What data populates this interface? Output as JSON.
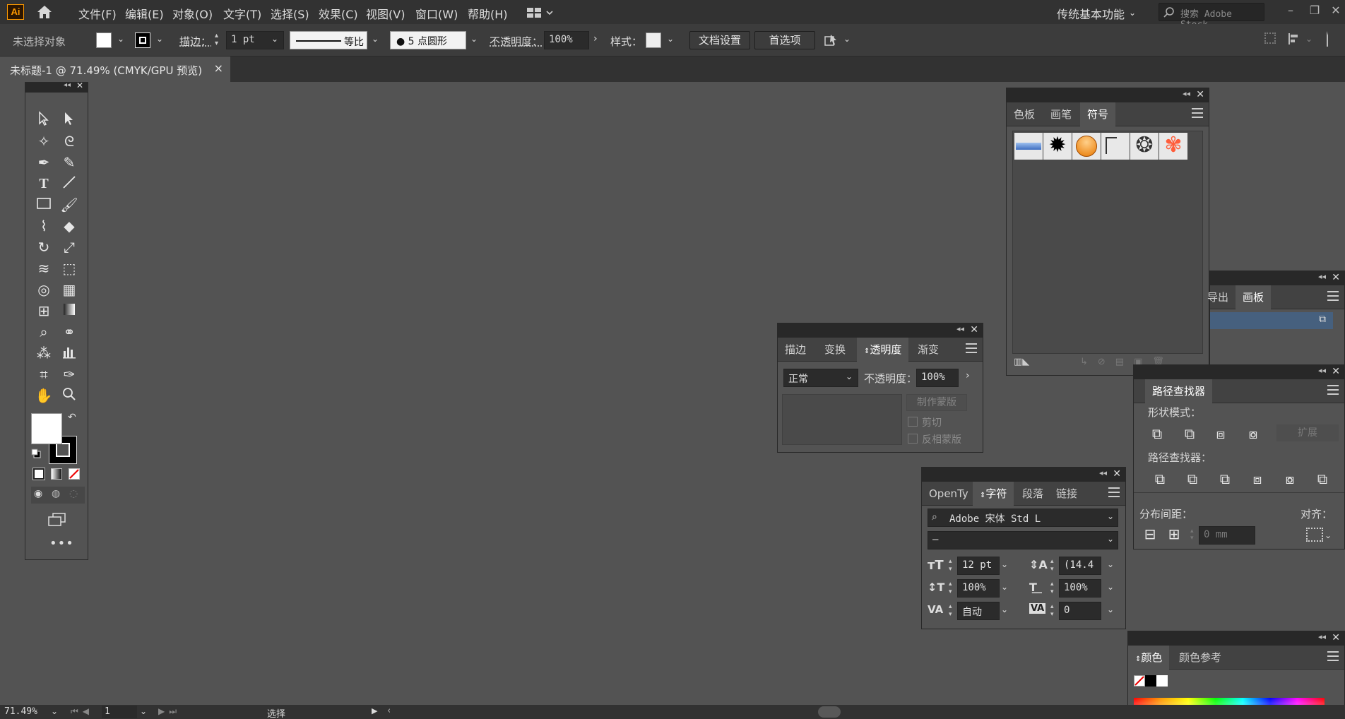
{
  "app": {
    "logo_text": "Ai"
  },
  "menu": [
    "文件(F)",
    "编辑(E)",
    "对象(O)",
    "文字(T)",
    "选择(S)",
    "效果(C)",
    "视图(V)",
    "窗口(W)",
    "帮助(H)"
  ],
  "workspace": "传统基本功能",
  "search": {
    "placeholder": "搜索 Adobe Stock"
  },
  "control": {
    "no_selection": "未选择对象",
    "stroke_label": "描边：",
    "stroke_value": "1 pt",
    "profile_label": "等比",
    "brush_label": "5 点圆形",
    "opacity_label": "不透明度：",
    "opacity_value": "100%",
    "style_label": "样式：",
    "doc_settings": "文档设置",
    "preferences": "首选项"
  },
  "document_tab": {
    "title": "未标题-1 @ 71.49% (CMYK/GPU 预览)",
    "close": "×"
  },
  "swatch_panel": {
    "tabs": [
      "色板",
      "画笔",
      "符号"
    ],
    "active": "符号"
  },
  "transparency_panel": {
    "tabs": [
      "描边",
      "变换",
      "透明度",
      "渐变"
    ],
    "active": "透明度",
    "blend_mode": "正常",
    "opacity_label": "不透明度：",
    "opacity_value": "100%",
    "make_mask": "制作蒙版",
    "clip": "剪切",
    "invert_mask": "反相蒙版"
  },
  "artboard_panel": {
    "tabs": [
      "导出",
      "画板"
    ],
    "active": "画板"
  },
  "pathfinder_panel": {
    "title": "路径查找器",
    "shape_modes": "形状模式：",
    "expand": "扩展",
    "pathfinders": "路径查找器：",
    "distribute": "分布间距：",
    "align": "对齐：",
    "spacing_value": "0 mm"
  },
  "character_panel": {
    "tabs": [
      "OpenTy",
      "字符",
      "段落",
      "链接"
    ],
    "active": "字符",
    "font_family": "Adobe 宋体 Std L",
    "font_style": "–",
    "font_size": "12 pt",
    "leading": "(14.4",
    "vscale": "100%",
    "hscale": "100%",
    "kerning": "自动",
    "tracking": "0"
  },
  "color_panel": {
    "tabs": [
      "颜色",
      "颜色参考"
    ],
    "active": "颜色"
  },
  "status": {
    "zoom": "71.49%",
    "page": "1",
    "tool": "选择"
  }
}
